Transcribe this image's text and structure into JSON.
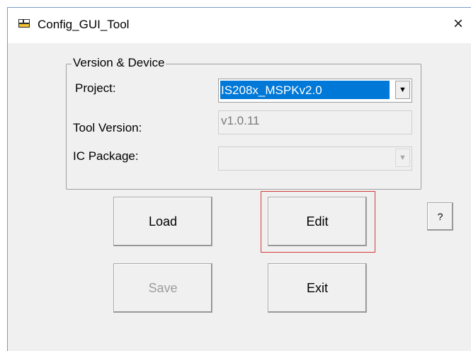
{
  "window": {
    "title": "Config_GUI_Tool",
    "close_glyph": "×",
    "icon": "app-icon"
  },
  "group": {
    "legend": "Version & Device",
    "project": {
      "label": "Project:",
      "value": "IS208x_MSPKv2.0"
    },
    "tool_version": {
      "label": "Tool Version:",
      "value": "v1.0.11"
    },
    "ic_package": {
      "label": "IC Package:",
      "value": ""
    }
  },
  "buttons": {
    "load": "Load",
    "edit": "Edit",
    "help": "?",
    "save": "Save",
    "exit": "Exit"
  },
  "colors": {
    "selection": "#0078d7",
    "focus_ring": "#d23b3b"
  }
}
